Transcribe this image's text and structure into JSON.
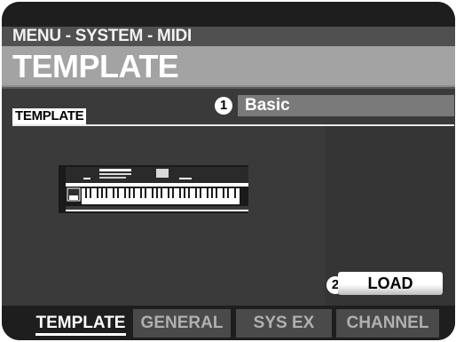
{
  "header": {
    "breadcrumb": "MENU - SYSTEM - MIDI",
    "title": "TEMPLATE"
  },
  "panel": {
    "section_label": "TEMPLATE",
    "template_value": "Basic",
    "callout_1": "1",
    "callout_2": "2",
    "load_button_label": "LOAD"
  },
  "tabs": [
    {
      "label": "TEMPLATE",
      "active": true
    },
    {
      "label": "GENERAL",
      "active": false
    },
    {
      "label": "SYS EX",
      "active": false
    },
    {
      "label": "CHANNEL",
      "active": false
    }
  ],
  "colors": {
    "screen_bg": "#2a2a2a",
    "titlebar": "#a3a3a3",
    "value_field": "#7a7a7a"
  }
}
